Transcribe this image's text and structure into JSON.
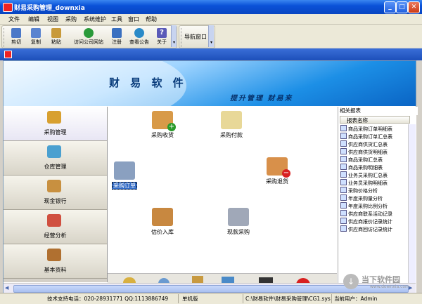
{
  "window": {
    "title": "财易采购管理_downxia"
  },
  "menu": [
    "文件",
    "编辑",
    "视图",
    "采购",
    "系统维护",
    "工具",
    "窗口",
    "帮助"
  ],
  "toolbar": {
    "buttons": [
      {
        "label": "剪切",
        "icon": "scissors-icon",
        "color": "#4a78c8"
      },
      {
        "label": "复制",
        "icon": "copy-icon",
        "color": "#5a84d0"
      },
      {
        "label": "粘贴",
        "icon": "paste-icon",
        "color": "#c89a3a"
      },
      {
        "label": "访问公司网站",
        "icon": "globe-icon",
        "color": "#2a9a3a"
      },
      {
        "label": "注册",
        "icon": "register-icon",
        "color": "#3a70c0"
      },
      {
        "label": "查看公告",
        "icon": "announcement-icon",
        "color": "#2a8ac8"
      },
      {
        "label": "关于",
        "icon": "help-icon",
        "color": "#5a5ab8"
      }
    ],
    "nav_window": "导航窗口"
  },
  "banner": {
    "title": "财 易 软 件",
    "slogan": "提升管理 财易来"
  },
  "sidebar": [
    {
      "label": "采购管理",
      "icon": "truck-icon",
      "color": "#d8a030",
      "active": true
    },
    {
      "label": "仓库管理",
      "icon": "warehouse-icon",
      "color": "#4aa0d0"
    },
    {
      "label": "现金银行",
      "icon": "cash-icon",
      "color": "#c89040"
    },
    {
      "label": "经营分析",
      "icon": "analysis-icon",
      "color": "#d05040"
    },
    {
      "label": "基本资料",
      "icon": "book-icon",
      "color": "#b07030"
    }
  ],
  "main_items": [
    {
      "label": "采购收货",
      "icon": "receive-goods-icon",
      "color": "#d89a48"
    },
    {
      "label": "采购付款",
      "icon": "payment-icon",
      "color": "#e8d898"
    },
    {
      "label": "采购订单",
      "icon": "order-icon",
      "color": "#8aa0c0",
      "selected": true
    },
    {
      "label": "采购退货",
      "icon": "return-goods-icon",
      "color": "#d8904a"
    },
    {
      "label": "估价入库",
      "icon": "boxes-icon",
      "color": "#c88840"
    },
    {
      "label": "现款采购",
      "icon": "cash-purchase-icon",
      "color": "#a0a8b8"
    }
  ],
  "right_panel": {
    "header": "相关报表",
    "column": "报表名称",
    "items": [
      "商品采购订单明细表",
      "商品采购订单汇总表",
      "供应商供货汇总表",
      "供应商供货明细表",
      "商品采购汇总表",
      "商品采购明细表",
      "业务员采购汇总表",
      "业务员采购明细表",
      "采购价格分析",
      "年度采购量分析",
      "年度采购比例分析",
      "供应商联系活动记录",
      "供应商报价记录统计",
      "供应商回访记录统计"
    ]
  },
  "status": {
    "support": "技术支持电话：020-28931771 QQ:1113886749",
    "edition": "单机版",
    "path": "C:\\财易软件\\财易采购管理\\CG1.sys",
    "operator": "当前用户：Admin"
  },
  "watermark": {
    "main": "当下软件园",
    "sub": "www.downxia.com"
  }
}
